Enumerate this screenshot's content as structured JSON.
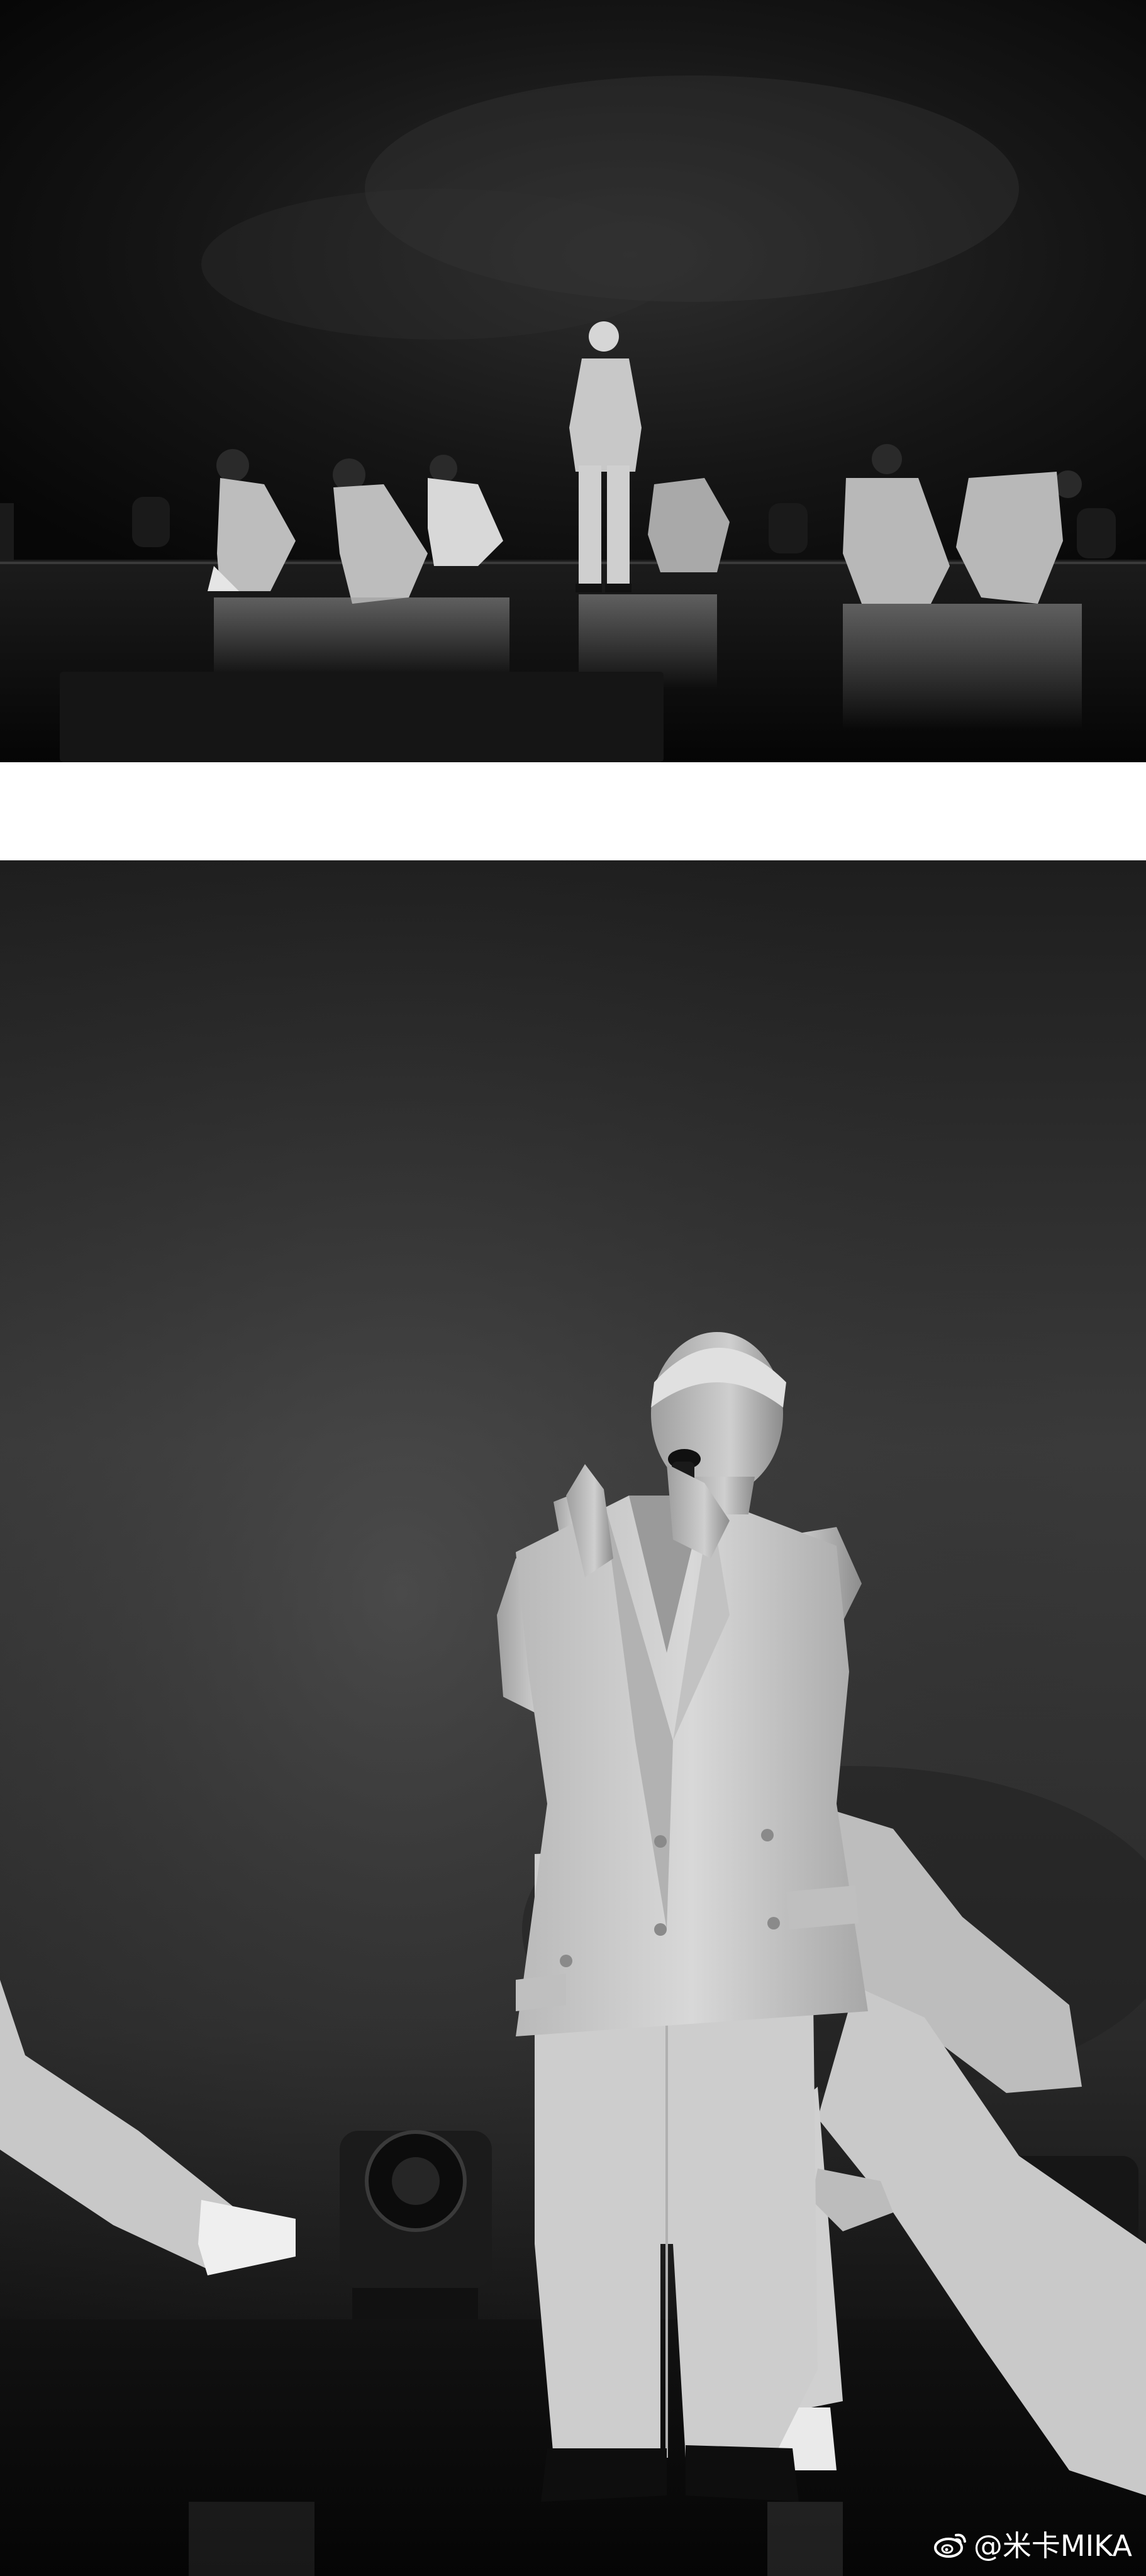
{
  "watermark": {
    "text": "@米卡MIKA",
    "icon": "weibo-logo-icon"
  }
}
